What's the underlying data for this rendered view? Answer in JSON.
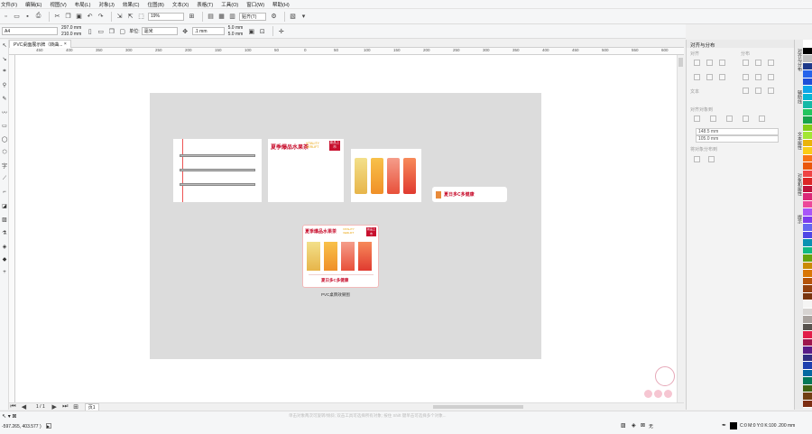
{
  "menu": [
    "文件(F)",
    "编辑(E)",
    "视图(V)",
    "布局(L)",
    "对象(J)",
    "效果(C)",
    "位图(B)",
    "文本(X)",
    "表格(T)",
    "工具(O)",
    "窗口(W)",
    "帮助(H)"
  ],
  "toolbar": {
    "zoom": "19%",
    "snap": "贴齐(T)"
  },
  "propbar": {
    "paper": "A4",
    "width": "297.0 mm",
    "height": "210.0 mm",
    "units_label": "单位:",
    "units": "毫米",
    "nudge": ".1 mm",
    "dup_x": "5.0 mm",
    "dup_y": "5.0 mm"
  },
  "document_tab": "PVC桌面展示牌（转曲...",
  "ruler": [
    "450",
    "400",
    "350",
    "300",
    "250",
    "200",
    "150",
    "100",
    "50",
    "0",
    "50",
    "100",
    "150",
    "200",
    "250",
    "300",
    "350",
    "400",
    "450",
    "500",
    "550",
    "600",
    "650"
  ],
  "canvas": {
    "header_title": "夏季爆品水果茶",
    "vitality_text": "VITALITY VERLIFT",
    "badge_text": "新品上市",
    "banner_text": "夏日多C多健康",
    "preview_caption": "PVC桌牌效果图"
  },
  "docker": {
    "title": "对齐与分布",
    "align_label": "对齐",
    "distribute_label": "分布",
    "text_label": "文本",
    "align_to_label": "对齐对象到",
    "x_value": "148.5 mm",
    "y_value": "105.0 mm",
    "distribute_to_label": "将对象分布到"
  },
  "side_tabs": [
    "对齐与分布",
    "辅助线",
    "文本属性",
    "对象和属性",
    "提示"
  ],
  "scrollbar": {
    "page_pos": "1 / 1",
    "page_tab": "页1"
  },
  "status": {
    "coords": "-597.265, 403.577 )",
    "hint": "单击对象两次可旋转/倾斜; 双击工具可选择所有对象; 按住 Shift 键单击可选择多个对象...",
    "none_label": "无",
    "color_info": "C:0 M:0 Y:0 K:100  .200 mm"
  },
  "palette": [
    "#ffffff",
    "#000000",
    "#c0c0c0",
    "#1e3a8a",
    "#2563eb",
    "#1d4ed8",
    "#0ea5e9",
    "#06b6d4",
    "#14b8a6",
    "#22c55e",
    "#16a34a",
    "#84cc16",
    "#a3e635",
    "#eab308",
    "#facc15",
    "#f97316",
    "#ea580c",
    "#ef4444",
    "#dc2626",
    "#be123c",
    "#db2777",
    "#ec4899",
    "#a855f7",
    "#7c3aed",
    "#6366f1",
    "#4f46e5",
    "#0891b2",
    "#10b981",
    "#65a30d",
    "#ca8a04",
    "#d97706",
    "#b45309",
    "#92400e",
    "#78350f",
    "#f5f5f4",
    "#d6d3d1",
    "#a8a29e",
    "#57534e",
    "#e11d48",
    "#9d174d",
    "#581c87",
    "#312e81",
    "#1e40af",
    "#0369a1",
    "#047857",
    "#3f6212",
    "#713f12",
    "#7c2d12"
  ],
  "colors": {
    "accent": "#c8102e",
    "page": "#dcdcdc"
  }
}
